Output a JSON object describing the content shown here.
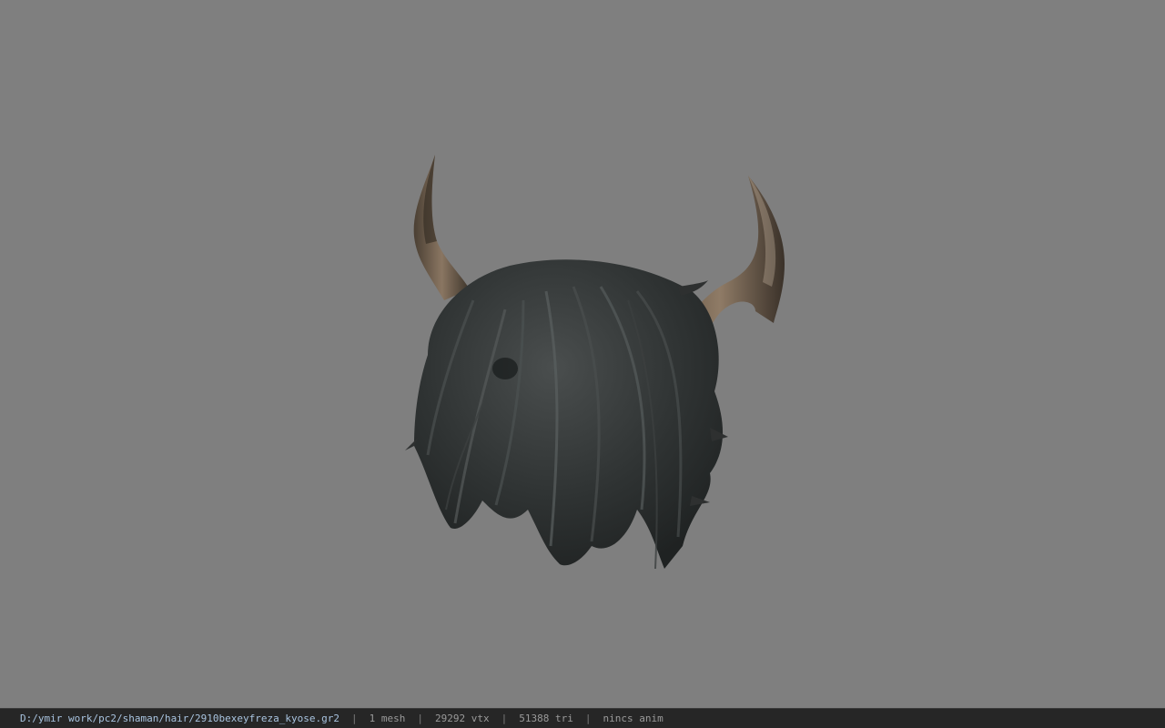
{
  "viewport": {
    "background_color": "#7f7f7f",
    "model": {
      "description_icon": "horned-hair-model",
      "hair_color": "#2e3030",
      "horn_color": "#6b5a45"
    }
  },
  "statusbar": {
    "file_path": "D:/ymir work/pc2/shaman/hair/2910bexeyfreza_kyose.gr2",
    "separator": "|",
    "mesh_count": "1 mesh",
    "vertex_count": "29292 vtx",
    "triangle_count": "51388 tri",
    "anim_status": "nincs anim"
  }
}
